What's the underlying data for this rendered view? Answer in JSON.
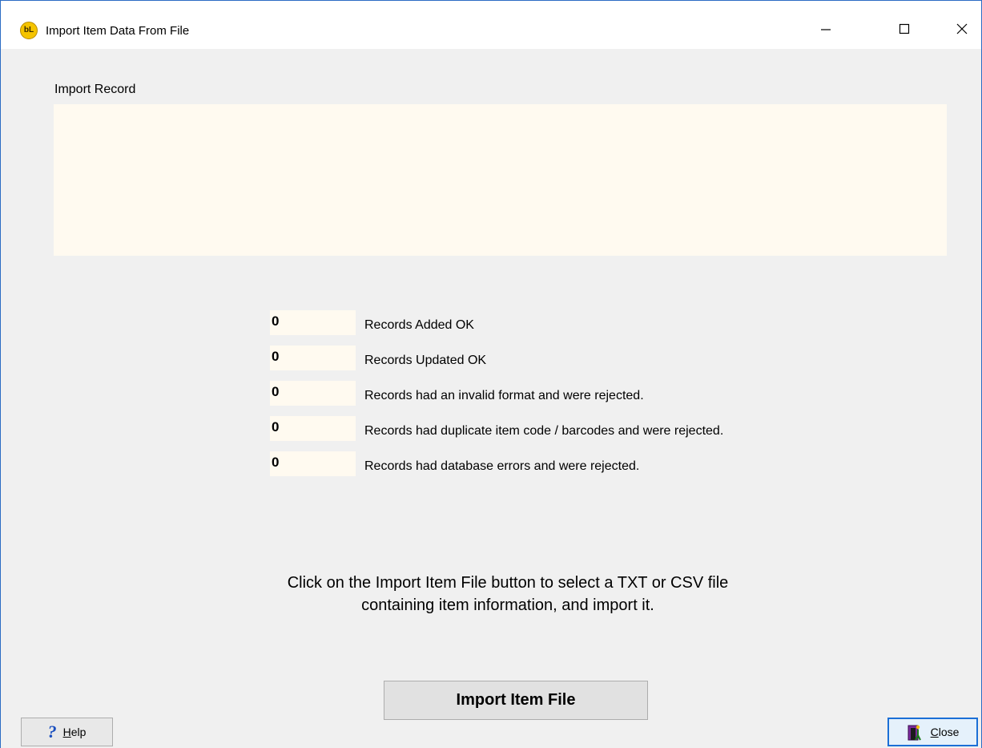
{
  "window": {
    "title": "Import Item Data From File",
    "icon_name": "bl-app-icon",
    "icon_text": "bL",
    "accent_color": "#2b6cc4"
  },
  "import_record": {
    "label": "Import Record",
    "content": ""
  },
  "stats": [
    {
      "value": "0",
      "label": "Records Added OK"
    },
    {
      "value": "0",
      "label": "Records Updated OK"
    },
    {
      "value": "0",
      "label": "Records had an invalid format and were rejected."
    },
    {
      "value": "0",
      "label": "Records had duplicate item code / barcodes and were rejected."
    },
    {
      "value": "0",
      "label": "Records had database errors and were rejected."
    }
  ],
  "instructions": {
    "line1": "Click on the Import Item File button to select a TXT or CSV file",
    "line2": "containing item information, and import it."
  },
  "buttons": {
    "import_label": "Import Item File",
    "help_label": "Help",
    "close_label": "Close"
  }
}
